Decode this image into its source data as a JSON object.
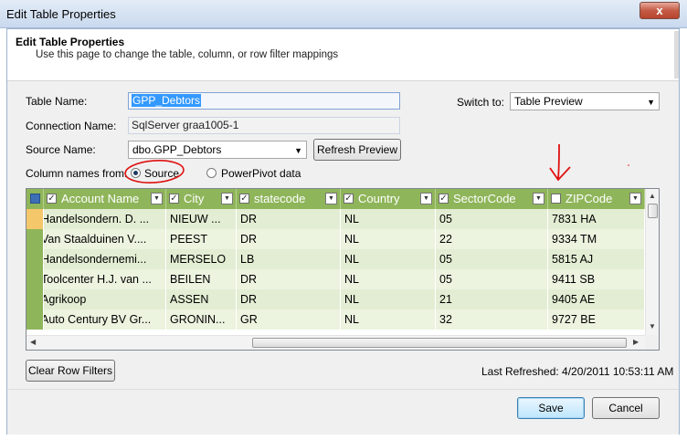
{
  "window": {
    "title": "Edit Table Properties",
    "close_glyph": "x"
  },
  "header": {
    "title": "Edit Table Properties",
    "subtitle": "Use this page to change the table, column, or row filter mappings"
  },
  "form": {
    "table_name_label": "Table Name:",
    "table_name_value": "GPP_Debtors",
    "connection_label": "Connection Name:",
    "connection_value": "SqlServer graa1005-1",
    "source_label": "Source Name:",
    "source_value": "dbo.GPP_Debtors",
    "refresh_label": "Refresh Preview",
    "switch_label": "Switch to:",
    "switch_value": "Table Preview",
    "colnames_label": "Column names from:",
    "radio_source": "Source",
    "radio_powerpivot": "PowerPivot data",
    "radio_selected": "Source"
  },
  "grid": {
    "columns": [
      {
        "name": "Account Name",
        "checked": true
      },
      {
        "name": "City",
        "checked": true
      },
      {
        "name": "statecode",
        "checked": true
      },
      {
        "name": "Country",
        "checked": true
      },
      {
        "name": "SectorCode",
        "checked": true
      },
      {
        "name": "ZIPCode",
        "checked": false
      }
    ],
    "rows": [
      [
        "Handelsondern. D. ...",
        "NIEUW ...",
        "DR",
        "NL",
        "05",
        "7831 HA"
      ],
      [
        "Van Staalduinen V....",
        "PEEST",
        "DR",
        "NL",
        "22",
        "9334 TM"
      ],
      [
        "Handelsondernemi...",
        "MERSELO",
        "LB",
        "NL",
        "05",
        "5815 AJ"
      ],
      [
        "Toolcenter H.J. van ...",
        "BEILEN",
        "DR",
        "NL",
        "05",
        "9411 SB"
      ],
      [
        "Agrikoop",
        "ASSEN",
        "DR",
        "NL",
        "21",
        "9405 AE"
      ],
      [
        "Auto Century BV Gr...",
        "GRONIN...",
        "GR",
        "NL",
        "32",
        "9727 BE"
      ]
    ]
  },
  "footer": {
    "clear_label": "Clear Row Filters",
    "last_refreshed": "Last Refreshed: 4/20/2011 10:53:11 AM",
    "save_label": "Save",
    "cancel_label": "Cancel"
  },
  "colors": {
    "header_green": "#8fb55a",
    "row_odd": "#e3edd3",
    "row_even": "#ecf3df",
    "annotation_red": "#e01010"
  }
}
